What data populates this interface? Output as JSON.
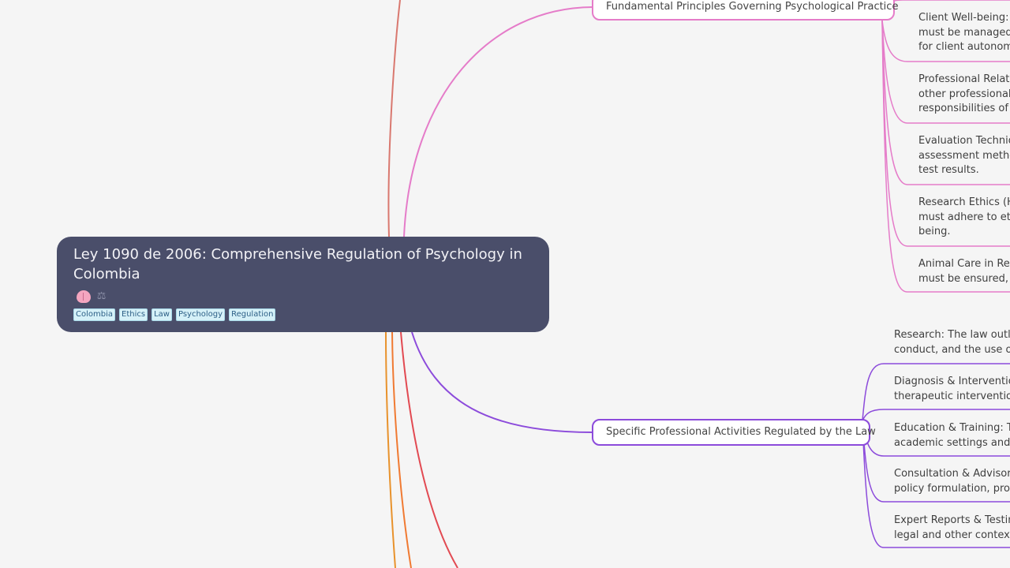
{
  "root": {
    "title": "Ley 1090 de 2006: Comprehensive Regulation of Psychology in Colombia",
    "icons": [
      "brain-icon",
      "scale-icon"
    ],
    "tags": [
      "Colombia",
      "Ethics",
      "Law",
      "Psychology",
      "Regulation"
    ]
  },
  "branches": [
    {
      "label": "Fundamental Principles Governing Psychological Practice",
      "color": "#e57cc9",
      "children": [
        [
          "Client Well-being:  P",
          "must be managed t",
          "for client autonomy"
        ],
        [
          "Professional Relatio",
          "other professionals",
          "responsibilities of e"
        ],
        [
          "Evaluation Techniqu",
          "assessment metho",
          "test results."
        ],
        [
          "Research Ethics (Hu",
          "must adhere to ethi",
          "being."
        ],
        [
          "Animal Care in Rese",
          "must be ensured, m"
        ]
      ]
    },
    {
      "label": "Specific Professional Activities Regulated by the Law",
      "color": "#8c4bdb",
      "children": [
        [
          "Research:  The law outlin",
          "conduct, and the use of h"
        ],
        [
          "Diagnosis & Intervention",
          "therapeutic intervention"
        ],
        [
          "Education & Training: Th",
          "academic settings and th"
        ],
        [
          "Consultation & Advisory",
          "policy formulation, progr"
        ],
        [
          "Expert Reports & Testimo",
          "legal and other contexts."
        ]
      ]
    }
  ],
  "colors": {
    "background": "#f5f5f5",
    "root_fill": "#4a4e6a",
    "offscreen_edges": [
      "#d9786f",
      "#e8922c",
      "#f07a32",
      "#e24a52"
    ]
  }
}
